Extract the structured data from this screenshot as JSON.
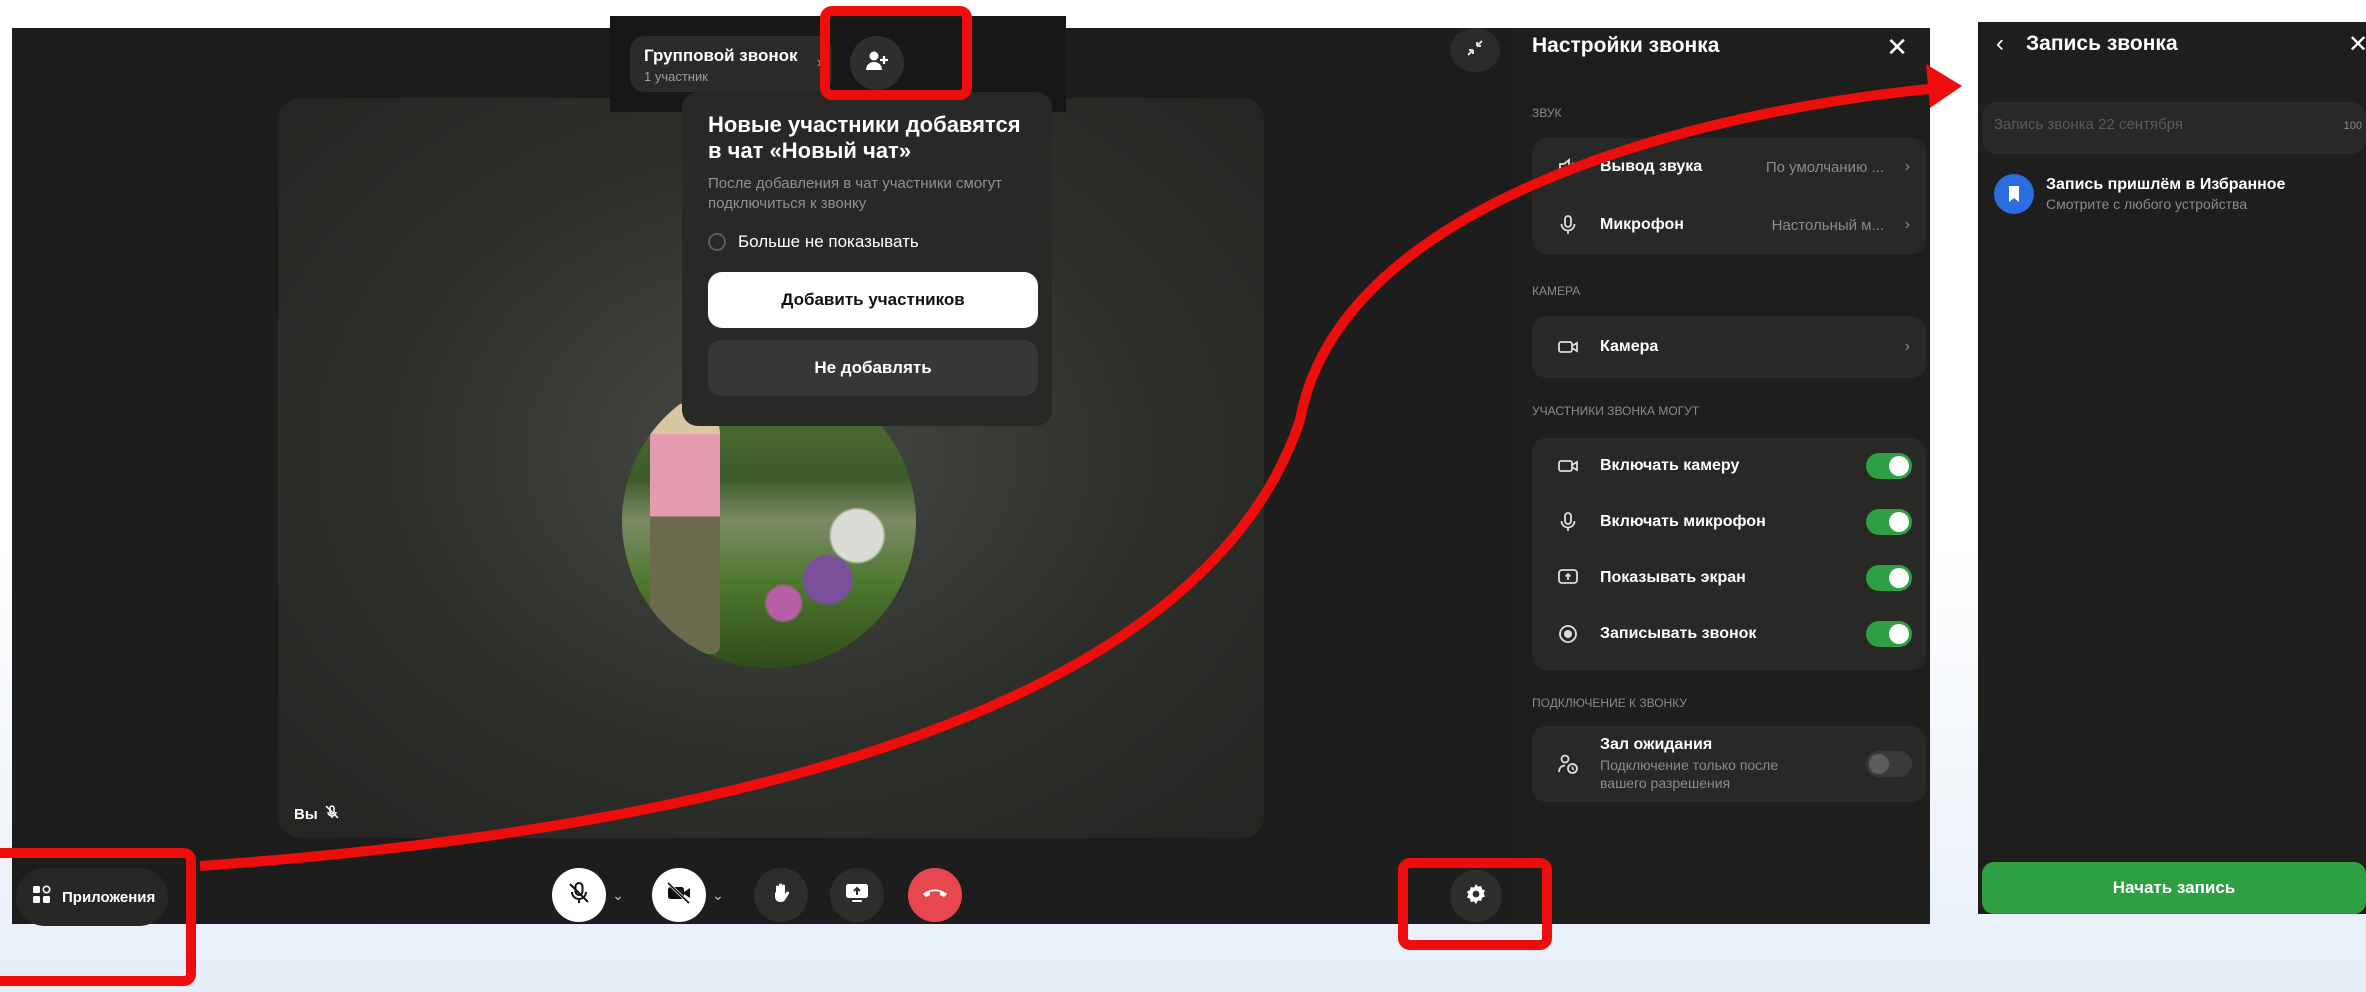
{
  "header": {
    "call_title": "Групповой звонок",
    "call_sub": "1 участник"
  },
  "popup": {
    "title": "Новые участники добавятся в чат «Новый чат»",
    "description": "После добавления в чат участники смогут подключиться к звонку",
    "dont_show_label": "Больше не показывать",
    "add_label": "Добавить участников",
    "skip_label": "Не добавлять"
  },
  "video": {
    "you_label": "Вы"
  },
  "bottom": {
    "apps_label": "Приложения"
  },
  "settings": {
    "title": "Настройки звонка",
    "section_sound": "Звук",
    "sound_output_label": "Вывод звука",
    "sound_output_value": "По умолчанию ...",
    "mic_label": "Микрофон",
    "mic_value": "Настольный м...",
    "section_camera": "Камера",
    "camera_label": "Камера",
    "section_participants": "Участники звонка могут",
    "perm_camera": "Включать камеру",
    "perm_mic": "Включать микрофон",
    "perm_screen": "Показывать экран",
    "perm_record": "Записывать звонок",
    "section_connection": "Подключение к звонку",
    "waiting_label": "Зал ожидания",
    "waiting_sub": "Подключение только после вашего разрешения",
    "toggles": {
      "perm_camera": true,
      "perm_mic": true,
      "perm_screen": true,
      "perm_record": true,
      "waiting": false
    }
  },
  "recording": {
    "title": "Запись звонка",
    "placeholder": "Запись звонка 22 сентября",
    "counter": "100",
    "info_title": "Запись пришлём в Избранное",
    "info_sub": "Смотрите с любого устройства",
    "start_label": "Начать запись"
  },
  "colors": {
    "accent_green": "#2ea043",
    "end_call_red": "#e8474f",
    "annotation_red": "#ee0d0d",
    "badge_blue": "#2b6de0"
  }
}
